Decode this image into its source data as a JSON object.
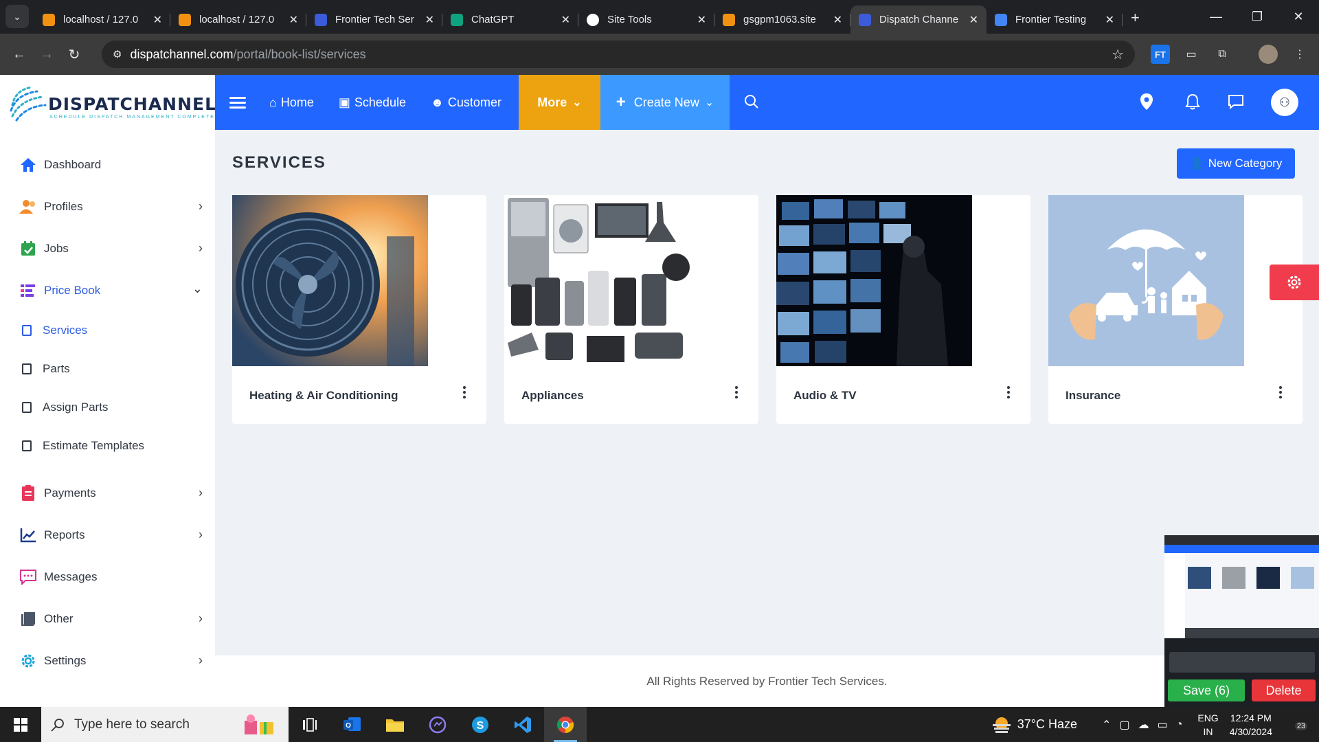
{
  "browser": {
    "tabs": [
      {
        "label": "localhost / 127.0",
        "fav": "#f29111",
        "active": false
      },
      {
        "label": "localhost / 127.0",
        "fav": "#f29111",
        "active": false
      },
      {
        "label": "Frontier Tech Ser",
        "fav": "#3b5bdb",
        "active": false
      },
      {
        "label": "ChatGPT",
        "fav": "#10a37f",
        "active": false
      },
      {
        "label": "Site Tools",
        "fav": "#ffffff",
        "active": false
      },
      {
        "label": "gsgpm1063.site",
        "fav": "#f29111",
        "active": false
      },
      {
        "label": "Dispatch Channe",
        "fav": "#3b5bdb",
        "active": true
      },
      {
        "label": "Frontier Testing",
        "fav": "#4285f4",
        "active": false
      }
    ],
    "url_host": "dispatchannel.com",
    "url_path": "/portal/book-list/services"
  },
  "brand": {
    "name": "DISPATCHANNEL",
    "tagline": "SCHEDULE DISPATCH MANAGEMENT COMPLETE"
  },
  "topnav": {
    "home": "Home",
    "schedule": "Schedule",
    "customer": "Customer",
    "more": "More",
    "create_new": "Create New"
  },
  "sidebar": {
    "dashboard": "Dashboard",
    "profiles": "Profiles",
    "jobs": "Jobs",
    "price_book": "Price Book",
    "services": "Services",
    "parts": "Parts",
    "assign_parts": "Assign Parts",
    "estimate_templates": "Estimate Templates",
    "payments": "Payments",
    "reports": "Reports",
    "messages": "Messages",
    "other": "Other",
    "settings": "Settings"
  },
  "page": {
    "title": "SERVICES",
    "new_category": "New Category"
  },
  "cards": [
    {
      "title": "Heating & Air Conditioning"
    },
    {
      "title": "Appliances"
    },
    {
      "title": "Audio & TV"
    },
    {
      "title": "Insurance"
    }
  ],
  "footer": "All Rights Reserved by Frontier Tech Services.",
  "capture": {
    "save": "Save (6)",
    "delete": "Delete"
  },
  "taskbar": {
    "search_placeholder": "Type here to search",
    "weather": "37°C  Haze",
    "lang_top": "ENG",
    "lang_bottom": "IN",
    "time": "12:24 PM",
    "date": "4/30/2024",
    "notifications": "23"
  },
  "colors": {
    "brand_blue": "#2166ff",
    "more_orange": "#eda20f",
    "create_blue": "#3c99ff",
    "settings_red": "#f03c4d"
  }
}
